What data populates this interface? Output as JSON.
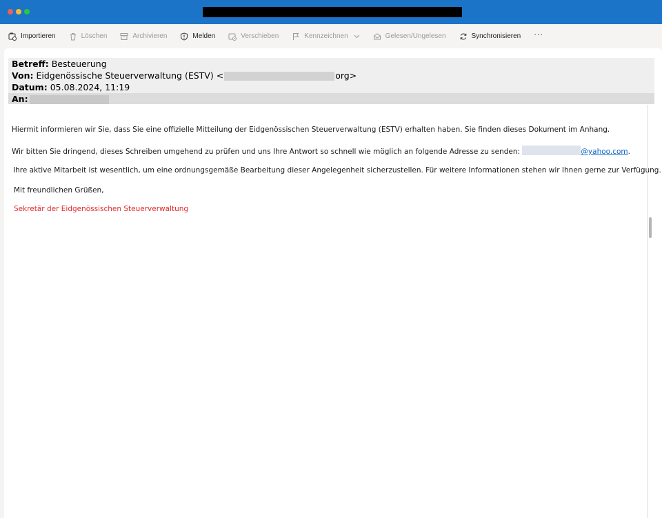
{
  "toolbar": {
    "items": [
      {
        "label": "Importieren",
        "icon": "import-icon",
        "enabled": true
      },
      {
        "label": "Löschen",
        "icon": "trash-icon",
        "enabled": false
      },
      {
        "label": "Archivieren",
        "icon": "archive-icon",
        "enabled": false
      },
      {
        "label": "Melden",
        "icon": "shield-icon",
        "enabled": true
      },
      {
        "label": "Verschieben",
        "icon": "move-icon",
        "enabled": false
      },
      {
        "label": "Kennzeichnen",
        "icon": "flag-icon",
        "enabled": false
      },
      {
        "label": "Gelesen/Ungelesen",
        "icon": "envelope-icon",
        "enabled": false
      },
      {
        "label": "Synchronisieren",
        "icon": "sync-icon",
        "enabled": true
      }
    ],
    "more": "···"
  },
  "header": {
    "subject_label": "Betreff:",
    "subject": "Besteuerung",
    "from_label": "Von:",
    "from_name": "Eidgenössische Steuerverwaltung (ESTV) <",
    "from_suffix": "org>",
    "date_label": "Datum:",
    "date": "05.08.2024, 11:19",
    "to_label": "An:"
  },
  "body": {
    "p1": "Hiermit informieren wir Sie, dass Sie eine offizielle Mitteilung der Eidgenössischen Steuerverwaltung (ESTV) erhalten haben. Sie finden dieses Dokument im Anhang.",
    "p2": "Wir bitten Sie dringend, dieses Schreiben umgehend zu prüfen und uns Ihre Antwort so schnell wie möglich an folgende Adresse zu senden: ",
    "p2_link": "@yahoo.com",
    "p2_end": ".",
    "p3": "Ihre aktive Mitarbeit ist wesentlich, um eine ordnungsgemäße Bearbeitung dieser Angelegenheit sicherzustellen. Für weitere Informationen stehen wir Ihnen gerne zur Verfügung.",
    "greeting": "Mit freundlichen Grüßen,",
    "signature": "Sekretär der Eidgenössischen Steuerverwaltung"
  },
  "colors": {
    "titlebar": "#1b74c8",
    "link": "#0b63c4",
    "signature": "#e42b2b"
  }
}
